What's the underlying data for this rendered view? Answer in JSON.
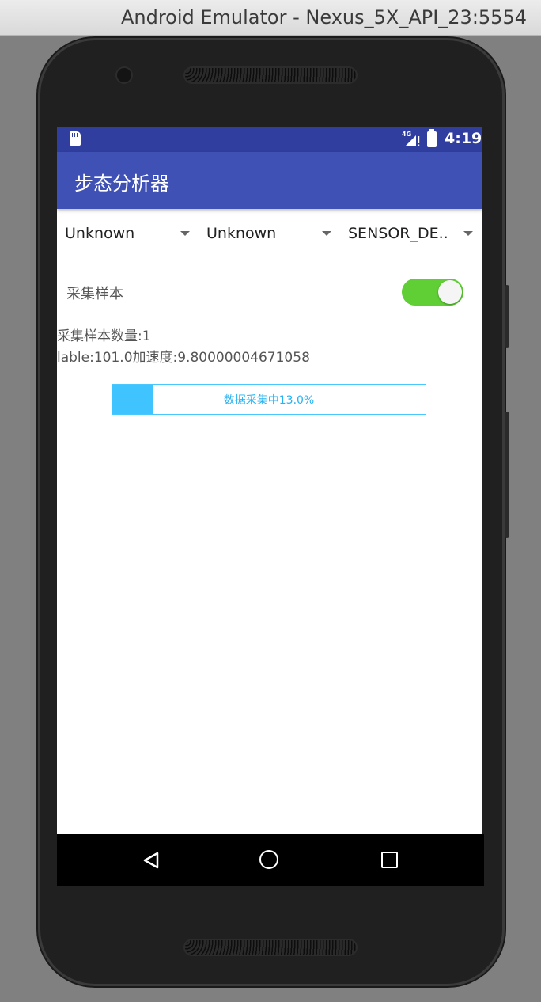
{
  "window": {
    "title": "Android Emulator - Nexus_5X_API_23:5554"
  },
  "status_bar": {
    "time": "4:19",
    "network_label": "4G"
  },
  "app_bar": {
    "title": "步态分析器"
  },
  "spinners": [
    {
      "value": "Unknown"
    },
    {
      "value": "Unknown"
    },
    {
      "value": "SENSOR_DE.."
    }
  ],
  "collect_switch": {
    "label": "采集样本",
    "on": true
  },
  "info": {
    "sample_count": "采集样本数量:1",
    "reading": "lable:101.0加速度:9.80000004671058"
  },
  "progress": {
    "text": "数据采集中13.0%",
    "percent": 13.0
  },
  "colors": {
    "primary": "#3f51b5",
    "primary_dark": "#303f9f",
    "switch_on": "#5fcf35",
    "progress": "#40c4ff"
  }
}
